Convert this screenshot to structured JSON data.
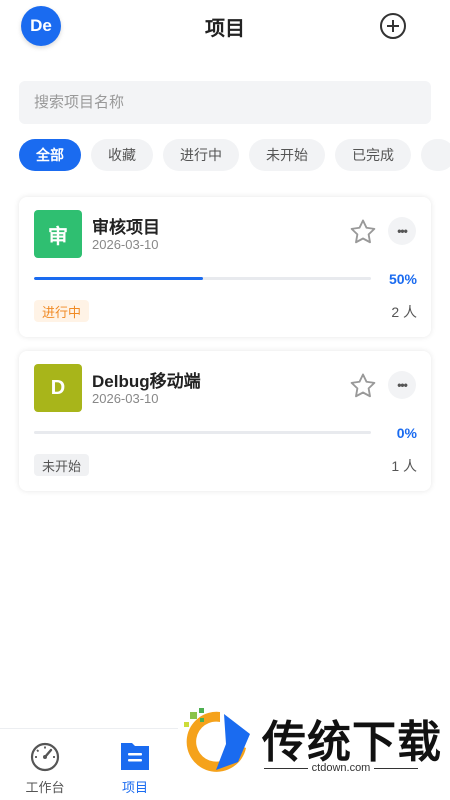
{
  "header": {
    "avatar_text": "De",
    "title": "项目",
    "add_icon": "plus-circle-icon"
  },
  "search": {
    "placeholder": "搜索项目名称",
    "value": ""
  },
  "filters": [
    {
      "label": "全部",
      "active": true
    },
    {
      "label": "收藏",
      "active": false
    },
    {
      "label": "进行中",
      "active": false
    },
    {
      "label": "未开始",
      "active": false
    },
    {
      "label": "已完成",
      "active": false
    }
  ],
  "projects": [
    {
      "icon_text": "审",
      "icon_color": "#2fbf71",
      "name": "审核项目",
      "date": "2026-03-10",
      "progress": 0.5,
      "percent_text": "50%",
      "status": "进行中",
      "status_bg": "#fff3e6",
      "status_color": "#f08a24",
      "members": "2 人"
    },
    {
      "icon_text": "D",
      "icon_color": "#a8b51a",
      "name": "Delbug移动端",
      "date": "2026-03-10",
      "progress": 0,
      "percent_text": "0%",
      "status": "未开始",
      "status_bg": "#f0f1f3",
      "status_color": "#555555",
      "members": "1 人"
    }
  ],
  "tabbar": {
    "items": [
      {
        "label": "工作台",
        "icon": "dashboard-gauge-icon",
        "active": false
      },
      {
        "label": "项目",
        "icon": "document-icon",
        "active": true
      }
    ]
  },
  "watermark": {
    "text": "传统下载",
    "url": "ctdown.com"
  },
  "colors": {
    "accent": "#1a6bf0",
    "star": "#999999"
  }
}
